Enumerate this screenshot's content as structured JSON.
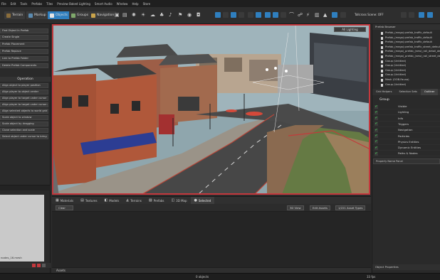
{
  "menu": [
    "File",
    "Edit",
    "Tools",
    "Prefabs",
    "Tiles",
    "Preview Baked Lighting",
    "Smart Audio",
    "Window",
    "Help",
    "Store"
  ],
  "toolbar": {
    "buttons": [
      {
        "label": "Terrain",
        "icon": "terrain-icon",
        "active": false
      },
      {
        "label": "Markup",
        "icon": "markup-icon",
        "active": false
      },
      {
        "label": "Objects",
        "icon": "objects-icon",
        "active": true
      },
      {
        "label": "Groups",
        "icon": "groups-icon",
        "active": false
      },
      {
        "label": "Navigation",
        "icon": "navigation-icon",
        "active": false
      }
    ],
    "scene_label": "Tollcross Scene: OFF",
    "accent": "#2f7fbf"
  },
  "left_panel": {
    "top_buttons": [
      "Find Object In Prefab",
      "Create Single",
      "Prefab Placement",
      "Prefab Replace",
      "Link to Prefab Folder",
      "Delete Prefab Components"
    ],
    "operation_title": "Operation",
    "operation_buttons": [
      "Align object to player position",
      "Align player to object center",
      "Align player to target under cursor",
      "Align player to target under cursor and rotation",
      "Align selected objects to world grid",
      "Scale object to window",
      "Scale object by dragging",
      "Clone selection and scale",
      "Select object under cursor to bring"
    ],
    "preview_file": "nodes_16.mesh"
  },
  "viewport": {
    "lighting_label": "All Lighting",
    "border_color": "#c4383d"
  },
  "bottom_panel": {
    "tabs": [
      {
        "label": "Materials",
        "glyph": "▦",
        "icon": "materials-icon",
        "active": false
      },
      {
        "label": "Textures",
        "glyph": "▤",
        "icon": "textures-icon",
        "active": false
      },
      {
        "label": "Models",
        "glyph": "◧",
        "icon": "models-icon",
        "active": false
      },
      {
        "label": "Terrains",
        "glyph": "◭",
        "icon": "terrains-icon",
        "active": false
      },
      {
        "label": "Prefabs",
        "glyph": "▨",
        "icon": "prefabs-icon",
        "active": false
      },
      {
        "label": "3D Map",
        "glyph": "◫",
        "icon": "map-icon",
        "active": false
      },
      {
        "label": "Selected",
        "glyph": "●",
        "icon": "selected-icon",
        "active": true
      }
    ],
    "clear_label": "Clear",
    "actions": [
      "3D View",
      "Edit Assets",
      "1/221 Asset Types"
    ],
    "assets_label": "Assets"
  },
  "right_panel": {
    "header": "Prefab Browser",
    "prefab_files": [
      "Prefab_(mega):prefab_traffic_default",
      "Prefab_(mega):prefab_traffic_default",
      "Prefab_(mega):prefab_traffic_default",
      "Prefab_(mega):prefab_traffic_street_default",
      "Prefab_(mega)_prefab_(new)_rail_detail_default",
      "Prefab_(mega)_prefab_(new)_rail_street_default",
      "Group (Untitled)",
      "Group (Untitled)",
      "Group (Untitled)",
      "Group (Untitled)",
      "Mesh (OOB-Fauna)",
      "Group (Untitled)"
    ],
    "tabs": [
      "Grid Helpers",
      "Selection Sets",
      "Outliner"
    ],
    "active_tab": "Outliner",
    "group_title": "Group",
    "groups": [
      {
        "label": "Visible",
        "checked": true
      },
      {
        "label": "Lighting",
        "checked": true
      },
      {
        "label": "Info",
        "checked": true
      },
      {
        "label": "Triggers",
        "checked": true
      },
      {
        "label": "Navigation",
        "checked": true
      },
      {
        "label": "Particles",
        "checked": true
      },
      {
        "label": "Physics Entities",
        "checked": true
      },
      {
        "label": "Dynamic Entities",
        "checked": true
      },
      {
        "label": "Paths & Nodes",
        "checked": true
      }
    ],
    "property_panel_label": "Property Name Panel",
    "object_properties_label": "Object Properties"
  },
  "status": {
    "objects_count": "0 objects",
    "fps": "33 fps"
  }
}
